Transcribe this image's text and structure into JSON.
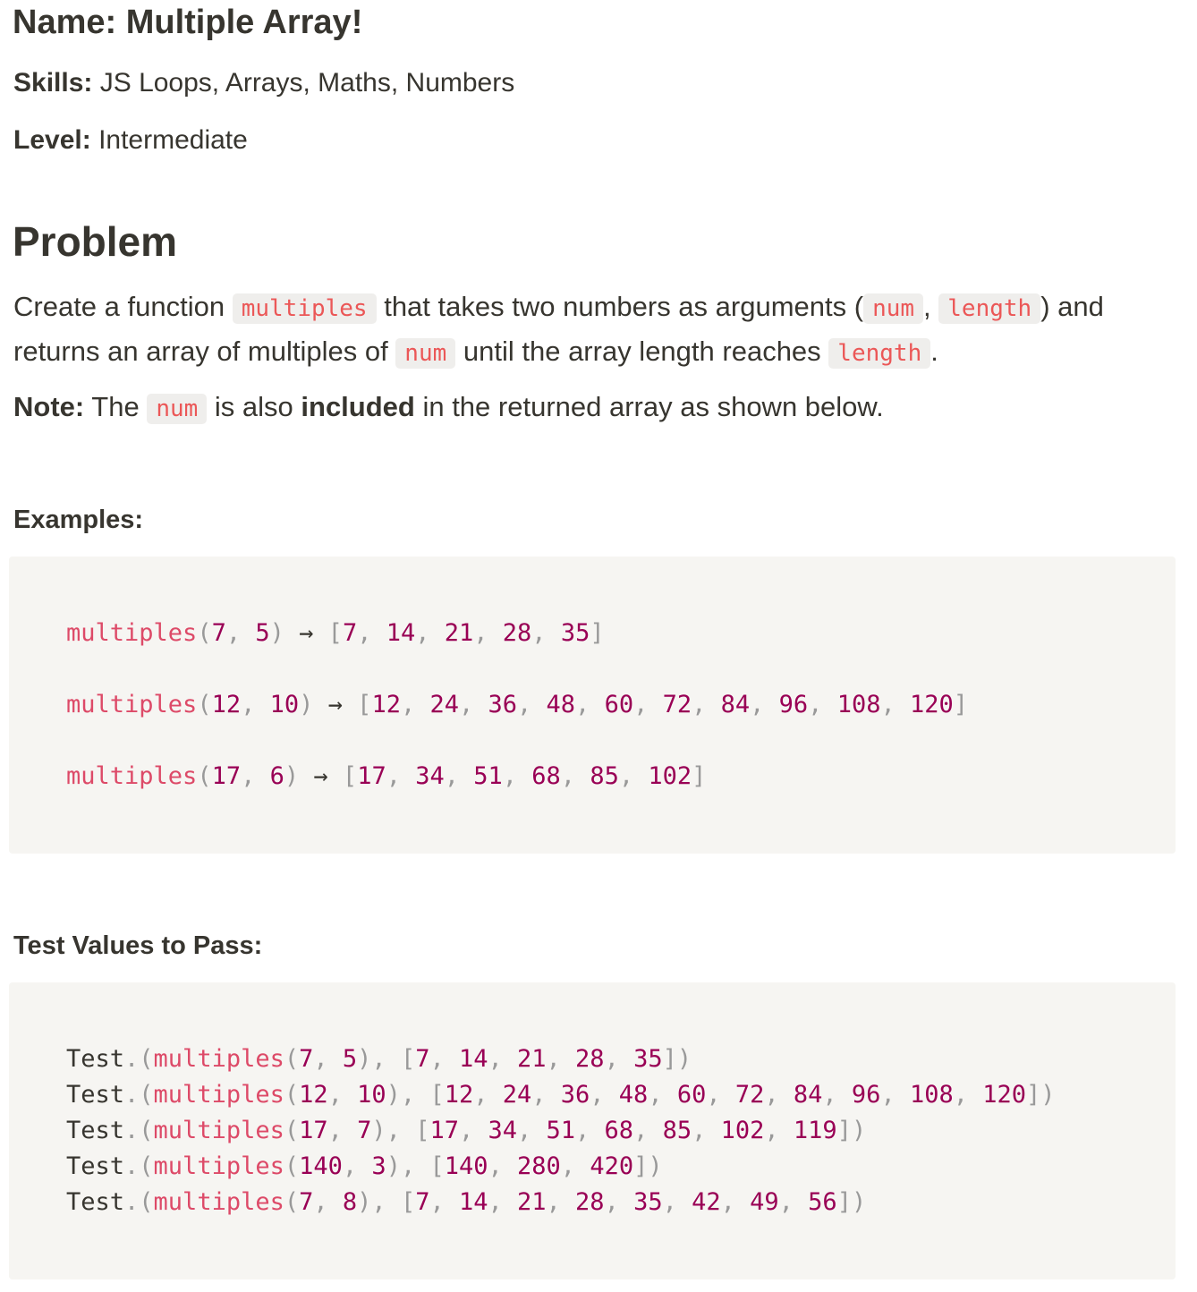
{
  "header": {
    "name_label": "Name:",
    "name_value": "Multiple Array!",
    "skills_label": "Skills:",
    "skills_value": "JS Loops, Arrays, Maths, Numbers",
    "level_label": "Level:",
    "level_value": "Intermediate"
  },
  "problem": {
    "heading": "Problem",
    "p1_a": "Create a function ",
    "p1_code1": "multiples",
    "p1_b": " that takes two numbers as arguments (",
    "p1_code2": "num",
    "p1_c": ", ",
    "p1_code3": "length",
    "p1_d": ") and returns an array of multiples of ",
    "p1_code4": "num",
    "p1_e": " until the array length reaches ",
    "p1_code5": "length",
    "p1_f": ".",
    "note_label": "Note:",
    "note_a": " The ",
    "note_code": "num",
    "note_b": " is also ",
    "note_bold": "included",
    "note_c": " in the returned array as shown below."
  },
  "examples": {
    "heading": "Examples:",
    "fn": "multiples",
    "arrow": "→",
    "items": [
      {
        "args": [
          "7",
          "5"
        ],
        "result": [
          "7",
          "14",
          "21",
          "28",
          "35"
        ]
      },
      {
        "args": [
          "12",
          "10"
        ],
        "result": [
          "12",
          "24",
          "36",
          "48",
          "60",
          "72",
          "84",
          "96",
          "108",
          "120"
        ]
      },
      {
        "args": [
          "17",
          "6"
        ],
        "result": [
          "17",
          "34",
          "51",
          "68",
          "85",
          "102"
        ]
      }
    ]
  },
  "tests": {
    "heading": "Test Values to Pass:",
    "prefix": "Test",
    "fn": "multiples",
    "items": [
      {
        "args": [
          "7",
          "5"
        ],
        "result": [
          "7",
          "14",
          "21",
          "28",
          "35"
        ]
      },
      {
        "args": [
          "12",
          "10"
        ],
        "result": [
          "12",
          "24",
          "36",
          "48",
          "60",
          "72",
          "84",
          "96",
          "108",
          "120"
        ]
      },
      {
        "args": [
          "17",
          "7"
        ],
        "result": [
          "17",
          "34",
          "51",
          "68",
          "85",
          "102",
          "119"
        ]
      },
      {
        "args": [
          "140",
          "3"
        ],
        "result": [
          "140",
          "280",
          "420"
        ]
      },
      {
        "args": [
          "7",
          "8"
        ],
        "result": [
          "7",
          "14",
          "21",
          "28",
          "35",
          "42",
          "49",
          "56"
        ]
      }
    ]
  }
}
